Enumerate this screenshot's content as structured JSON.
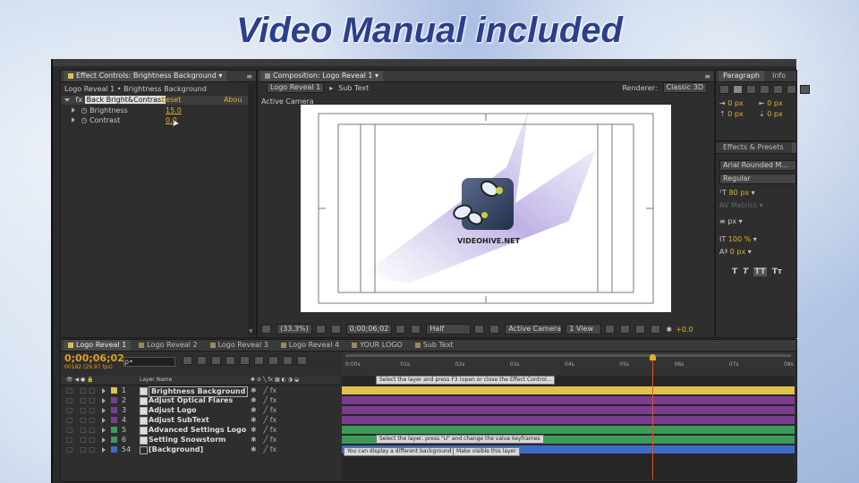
{
  "headline": "Video Manual included",
  "effect_controls": {
    "tab_label": "Effect Controls: Brightness Background",
    "breadcrumb": "Logo Reveal 1 • Brightness Background",
    "effect_name": "Back Bright&Contrast",
    "reset": "Reset",
    "about": "Abou",
    "brightness_label": "Brightness",
    "brightness_value": "15.0",
    "contrast_label": "Contrast",
    "contrast_value": "0.0"
  },
  "composition": {
    "tab_label": "Composition: Logo Reveal 1",
    "crumb1": "Logo Reveal 1",
    "crumb2": "Sub Text",
    "renderer_label": "Renderer:",
    "renderer_value": "Classic 3D",
    "active_camera": "Active Camera",
    "logo_text": "VIDEOHIVE.NET",
    "zoom": "(33,3%)",
    "timecode": "0;00;06;02",
    "resolution": "Half",
    "view_camera": "Active Camera",
    "view_count": "1 View",
    "exposure": "+0.0"
  },
  "paragraph": {
    "tab_paragraph": "Paragraph",
    "tab_info": "Info",
    "px1": "0 px",
    "px2": "0 px",
    "px3": "0 px",
    "px4": "0 px"
  },
  "character": {
    "tab_effects": "Effects & Presets",
    "tab_ch": "Ch",
    "font": "Arial Rounded M...",
    "style": "Regular",
    "size": "80 px",
    "metrics": "Metrics",
    "leading_unit": "px",
    "scale": "100 %",
    "baseline": "0 px",
    "t_buttons": [
      "T",
      "T",
      "TT",
      "Tᴛ"
    ]
  },
  "timeline": {
    "tabs": [
      "Logo Reveal 1",
      "Logo Reveal 2",
      "Logo Reveal 3",
      "Logo Reveal 4",
      "YOUR LOGO",
      "Sub Text"
    ],
    "timecode": "0;00;06;02",
    "fps": "00182 (29.97 fps)",
    "search_placeholder": "ρ•",
    "col_layer_name": "Layer Name",
    "ruler": [
      "0:00s",
      "01s",
      "02s",
      "03s",
      "04s",
      "05s",
      "06s",
      "07s",
      "08s"
    ],
    "layers": [
      {
        "num": "1",
        "name": "Brightness Background",
        "color": "#e0c050"
      },
      {
        "num": "2",
        "name": "Adjust Optical Flares",
        "color": "#7a3d8f"
      },
      {
        "num": "3",
        "name": "Adjust Logo",
        "color": "#7a3d8f"
      },
      {
        "num": "4",
        "name": "Adjust SubText",
        "color": "#7a3d8f"
      },
      {
        "num": "5",
        "name": "Advanced Settings Logo",
        "color": "#3d9a5a"
      },
      {
        "num": "6",
        "name": "Setting Snowstorm",
        "color": "#3d9a5a"
      },
      {
        "num": "54",
        "name": "[Background]",
        "color": "#3c6cc8"
      }
    ],
    "tips": {
      "tip1": "Select the layer and press F3 (open or close the Effect Control...",
      "tip2": "Select the layer, press \"U\" and change the value keyframes",
      "tip3": "You can display a different background",
      "tip4": "Make visible this layer"
    },
    "current_time_fraction": 0.7
  },
  "colors": {
    "headline": "#2b3f8c",
    "layer_yellow": "#e0c050",
    "layer_purple": "#7a3d8f",
    "layer_green": "#3d9a5a",
    "layer_blue": "#3c6cc8",
    "playhead": "#e05030"
  }
}
